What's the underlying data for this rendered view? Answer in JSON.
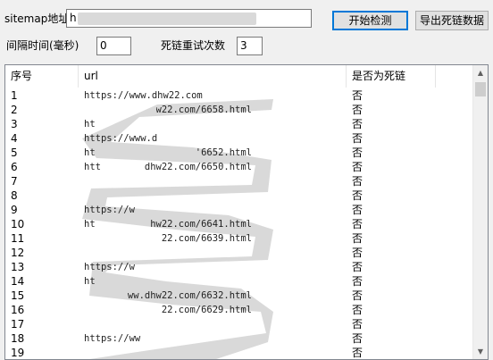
{
  "toolbar": {
    "sitemap_label": "sitemap地址",
    "sitemap_value": "h",
    "start_check_label": "开始检测",
    "export_label": "导出死链数据",
    "interval_label": "间隔时间(毫秒)",
    "interval_value": "0",
    "retry_label": "死链重试次数",
    "retry_value": "3"
  },
  "table": {
    "headers": {
      "index": "序号",
      "url": "url",
      "is_dead": "是否为死链"
    },
    "rows": [
      {
        "index": "1",
        "url": "https://www.dhw22.com",
        "is_dead": "否"
      },
      {
        "index": "2",
        "url": "",
        "is_dead": "否"
      },
      {
        "index": "3",
        "url": "",
        "is_dead": "否"
      },
      {
        "index": "4",
        "url": "",
        "is_dead": "否"
      },
      {
        "index": "5",
        "url": "",
        "is_dead": "否"
      },
      {
        "index": "6",
        "url": "",
        "is_dead": "否"
      },
      {
        "index": "7",
        "url": "",
        "is_dead": "否"
      },
      {
        "index": "8",
        "url": "",
        "is_dead": "否"
      },
      {
        "index": "9",
        "url": "",
        "is_dead": "否"
      },
      {
        "index": "10",
        "url": "",
        "is_dead": "否"
      },
      {
        "index": "11",
        "url": "",
        "is_dead": "否"
      },
      {
        "index": "12",
        "url": "",
        "is_dead": "否"
      },
      {
        "index": "13",
        "url": "",
        "is_dead": "否"
      },
      {
        "index": "14",
        "url": "",
        "is_dead": "否"
      },
      {
        "index": "15",
        "url": "",
        "is_dead": "否"
      },
      {
        "index": "16",
        "url": "",
        "is_dead": "否"
      },
      {
        "index": "17",
        "url": "",
        "is_dead": "否"
      },
      {
        "index": "18",
        "url": "",
        "is_dead": "否"
      },
      {
        "index": "19",
        "url": "",
        "is_dead": "否"
      }
    ],
    "url_fragments": [
      {
        "row": 1,
        "left": "",
        "right": ""
      },
      {
        "row": 2,
        "left": "",
        "right": "w22.com/6658.html"
      },
      {
        "row": 3,
        "left": "ht",
        "right": ""
      },
      {
        "row": 4,
        "left": "https://www.d",
        "right": ""
      },
      {
        "row": 5,
        "left": "ht",
        "right": "'6652.html"
      },
      {
        "row": 6,
        "left": "htt",
        "right": "dhw22.com/6650.html"
      },
      {
        "row": 7,
        "left": "",
        "right": ""
      },
      {
        "row": 8,
        "left": "",
        "right": ""
      },
      {
        "row": 9,
        "left": "https://w",
        "right": ""
      },
      {
        "row": 10,
        "left": "ht",
        "right": "hw22.com/6641.html"
      },
      {
        "row": 11,
        "left": "",
        "right": "22.com/6639.html"
      },
      {
        "row": 12,
        "left": "",
        "right": ""
      },
      {
        "row": 13,
        "left": "https://w",
        "right": ""
      },
      {
        "row": 14,
        "left": "ht",
        "right": ""
      },
      {
        "row": 15,
        "left": "",
        "right": "ww.dhw22.com/6632.html"
      },
      {
        "row": 16,
        "left": "",
        "right": "22.com/6629.html"
      },
      {
        "row": 17,
        "left": "",
        "right": ""
      },
      {
        "row": 18,
        "left": "https://ww",
        "right": ""
      },
      {
        "row": 19,
        "left": "",
        "right": ""
      }
    ]
  },
  "colors": {
    "window_bg": "#f0f0f0",
    "border": "#828790",
    "primary_border": "#0078d7",
    "blur": "#d9d9d9"
  }
}
